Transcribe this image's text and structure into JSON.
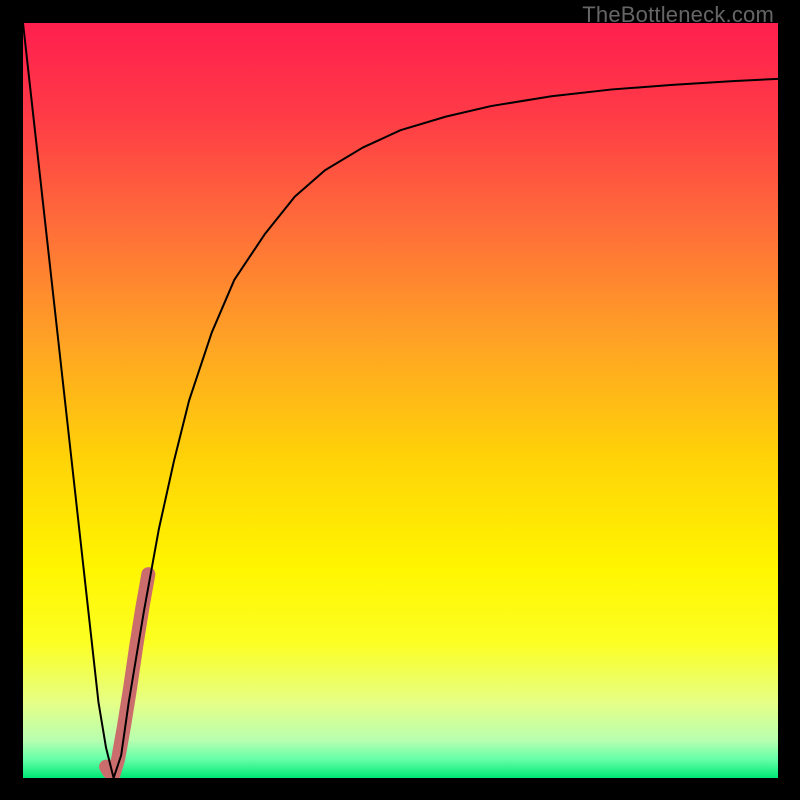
{
  "watermark": "TheBottleneck.com",
  "chart_data": {
    "type": "line",
    "title": "",
    "xlabel": "",
    "ylabel": "",
    "xlim": [
      0,
      100
    ],
    "ylim": [
      0,
      100
    ],
    "grid": false,
    "legend": false,
    "annotations": [],
    "background_gradient_stops": [
      {
        "pos": 0.0,
        "color": "#ff1f4e"
      },
      {
        "pos": 0.12,
        "color": "#ff3a47"
      },
      {
        "pos": 0.26,
        "color": "#ff6a3a"
      },
      {
        "pos": 0.42,
        "color": "#ffa225"
      },
      {
        "pos": 0.58,
        "color": "#ffd407"
      },
      {
        "pos": 0.72,
        "color": "#fff500"
      },
      {
        "pos": 0.82,
        "color": "#fcff22"
      },
      {
        "pos": 0.9,
        "color": "#e6ff86"
      },
      {
        "pos": 0.95,
        "color": "#b8ffb0"
      },
      {
        "pos": 0.975,
        "color": "#66ffa8"
      },
      {
        "pos": 1.0,
        "color": "#00e874"
      }
    ],
    "series": [
      {
        "name": "main-curve",
        "stroke": "#000000",
        "stroke_width": 2,
        "x": [
          0,
          2,
          4,
          6,
          8,
          10,
          11,
          12,
          13,
          14,
          16,
          18,
          20,
          22,
          25,
          28,
          32,
          36,
          40,
          45,
          50,
          56,
          62,
          70,
          78,
          86,
          94,
          100
        ],
        "y": [
          100,
          82,
          64,
          46,
          28,
          10,
          4,
          0,
          3,
          10,
          22,
          33,
          42,
          50,
          59,
          66,
          72,
          77,
          80.5,
          83.5,
          85.8,
          87.6,
          89,
          90.3,
          91.2,
          91.8,
          92.3,
          92.6
        ]
      },
      {
        "name": "highlight-segment",
        "stroke": "#cc6d6d",
        "stroke_width": 14,
        "x": [
          11.0,
          11.4,
          12.0,
          12.6,
          13.4,
          14.2,
          15.0,
          15.8,
          16.6
        ],
        "y": [
          1.5,
          0.8,
          0.5,
          2.5,
          7.0,
          12.0,
          17.5,
          22.5,
          27.0
        ]
      }
    ]
  }
}
